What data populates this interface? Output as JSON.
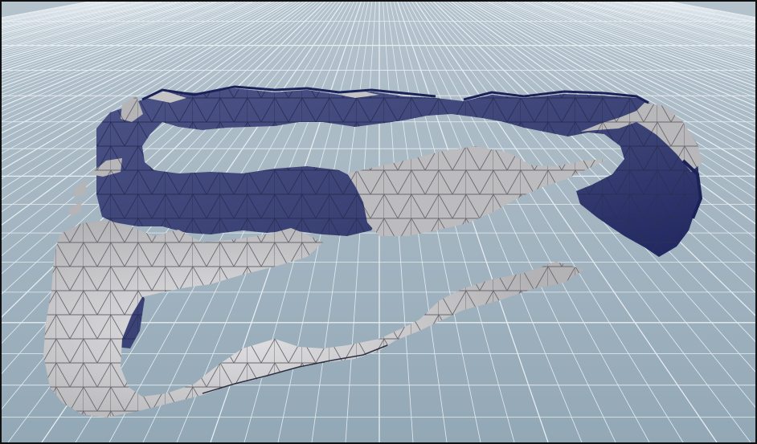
{
  "viewport": {
    "name": "3d-perspective-viewport",
    "background_top": "#aebdc9",
    "background_bottom": "#8fa4b2",
    "grid_color": "#e6edf2",
    "grid_minor_color": "#c8d5de"
  },
  "mesh": {
    "name": "torn-ring-surface",
    "front_face_color": "#b9b8b9",
    "back_face_color": "#3d4478",
    "wire_color": "#5d5d66",
    "has_triangulated_wireframe": true
  }
}
